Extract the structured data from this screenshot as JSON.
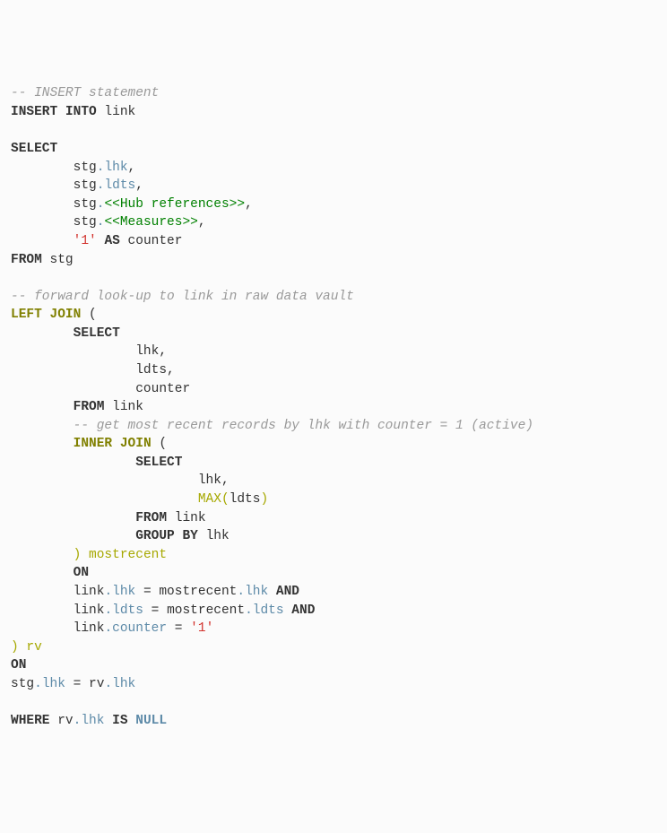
{
  "code": {
    "l01_comment": "-- INSERT statement",
    "l02_insert": "INSERT INTO",
    "l02_tbl": "link",
    "l04_select": "SELECT",
    "l05_stg": "stg",
    "l05_field": "lhk",
    "l06_stg": "stg",
    "l06_field": "ldts",
    "l07_stg": "stg",
    "l07_tpl_open": "<<",
    "l07_tpl_text": "Hub references",
    "l07_tpl_close": ">>",
    "l08_stg": "stg",
    "l08_tpl_open": "<<",
    "l08_tpl_text": "Measures",
    "l08_tpl_close": ">>",
    "l09_lit": "'1'",
    "l09_as": "AS",
    "l09_alias": "counter",
    "l10_from": "FROM",
    "l10_tbl": "stg",
    "l12_comment": "-- forward look-up to link in raw data vault",
    "l13_leftjoin": "LEFT JOIN",
    "l14_select": "SELECT",
    "l15_field": "lhk",
    "l16_field": "ldts",
    "l17_field": "counter",
    "l18_from": "FROM",
    "l18_tbl": "link",
    "l19_comment": "-- get most recent records by lhk with counter = 1 (active)",
    "l20_innerjoin": "INNER JOIN",
    "l21_select": "SELECT",
    "l22_field": "lhk",
    "l23_max": "MAX",
    "l23_arg": "ldts",
    "l24_from": "FROM",
    "l24_tbl": "link",
    "l25_groupby": "GROUP BY",
    "l25_field": "lhk",
    "l26_alias": "mostrecent",
    "l27_on": "ON",
    "l28_l": "link",
    "l28_lf": "lhk",
    "l28_eq": "=",
    "l28_r": "mostrecent",
    "l28_rf": "lhk",
    "l28_and": "AND",
    "l29_l": "link",
    "l29_lf": "ldts",
    "l29_eq": "=",
    "l29_r": "mostrecent",
    "l29_rf": "ldts",
    "l29_and": "AND",
    "l30_l": "link",
    "l30_lf": "counter",
    "l30_eq": "=",
    "l30_lit": "'1'",
    "l31_alias": "rv",
    "l32_on": "ON",
    "l33_l": "stg",
    "l33_lf": "lhk",
    "l33_eq": "=",
    "l33_r": "rv",
    "l33_rf": "lhk",
    "l35_where": "WHERE",
    "l35_l": "rv",
    "l35_lf": "lhk",
    "l35_is": "IS",
    "l35_null": "NULL",
    "dot": ".",
    "comma": ",",
    "open_paren": "(",
    "close_paren": ")"
  }
}
